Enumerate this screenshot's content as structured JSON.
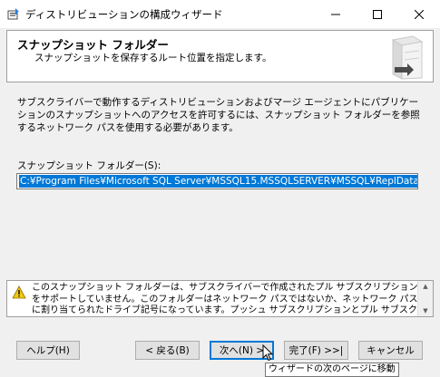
{
  "window": {
    "title": "ディストリビューションの構成ウィザード",
    "icon": "wizard-app-icon",
    "controls": {
      "minimize": "minimize-icon",
      "maximize": "maximize-icon",
      "close": "close-icon"
    }
  },
  "header": {
    "title": "スナップショット フォルダー",
    "subtitle": "スナップショットを保存するルート位置を指定します。",
    "graphic": "server-graphic"
  },
  "main": {
    "description": "サブスクライバーで動作するディストリビューションおよびマージ エージェントにパブリケーションのスナップショットへのアクセスを許可するには、スナップショット フォルダーを参照するネットワーク パスを使用する必要があります。",
    "field_label": "スナップショット フォルダー(S):",
    "field_value": "C:¥Program Files¥Microsoft SQL Server¥MSSQL15.MSSQLSERVER¥MSSQL¥ReplData"
  },
  "warning": {
    "icon": "warning-icon",
    "text": "このスナップショット フォルダーは、サブスクライバーで作成されたプル サブスクリプションをサポートしていません。このフォルダーはネットワーク パスではないか、ネットワーク パスに割り当てられたドライブ記号になっています。プッシュ サブスクリプションとプル サブスクリプションの両方を"
  },
  "buttons": {
    "help": "ヘルプ(H)",
    "back": "< 戻る(B)",
    "next": "次へ(N) >",
    "finish": "完了(F) >>|",
    "cancel": "キャンセル"
  },
  "tooltip": {
    "text": "ウィザードの次のページに移動"
  },
  "colors": {
    "selection": "#0078d7",
    "warning": "#f2c811"
  }
}
